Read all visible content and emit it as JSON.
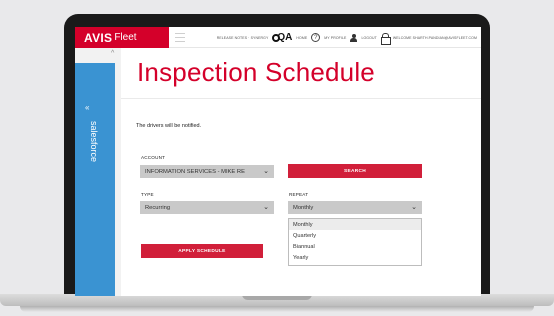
{
  "brand": {
    "name": "AVIS",
    "product": "Fleet"
  },
  "header": {
    "release_label": "RELEASE NOTES · SYNERGY",
    "qa_badge": "QA",
    "help_label": "HOME",
    "help_glyph": "?",
    "profile_label": "MY PROFILE",
    "logout_label": "LOGOUT",
    "welcome_text": "WELCOME SHARTH.PANDIAN@AVISFLEET.COM"
  },
  "sidebar": {
    "collapse_glyph": "«",
    "label": "salesforce",
    "scroll_glyph": "^"
  },
  "page": {
    "title": "Inspection Schedule",
    "note": "The drivers will be notified."
  },
  "form": {
    "account": {
      "label": "ACCOUNT",
      "value": "INFORMATION SERVICES - MIKE RE"
    },
    "search_button": "SEARCH",
    "type": {
      "label": "TYPE",
      "value": "Recurring"
    },
    "repeat": {
      "label": "REPEAT",
      "value": "Monthly",
      "options": [
        "Monthly",
        "Quarterly",
        "Biannual",
        "Yearly"
      ]
    },
    "apply_button": "APPLY SCHEDULE"
  },
  "colors": {
    "brand_red": "#d4002a",
    "button_red": "#d11f3a",
    "sidebar_blue": "#3a93d2",
    "select_gray": "#c9c9c9"
  }
}
